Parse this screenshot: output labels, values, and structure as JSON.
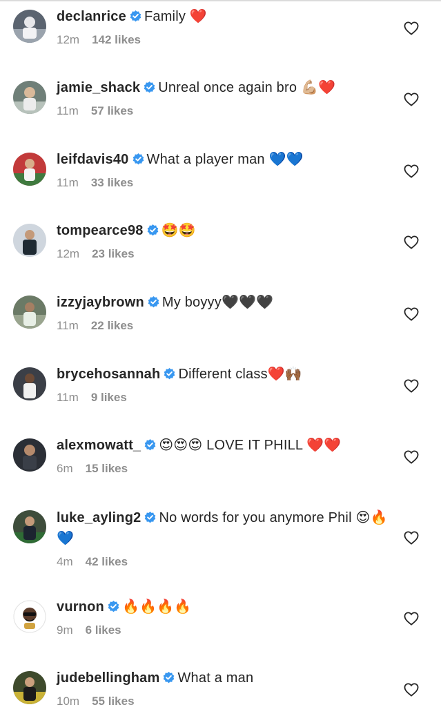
{
  "colors": {
    "text": "#262626",
    "muted": "#8e8e8e",
    "verified": "#3897f0",
    "divider": "#dbdbdb"
  },
  "icons": {
    "verified": "verified-badge-icon",
    "like": "heart-outline-icon"
  },
  "comments": [
    {
      "username": "declanrice",
      "text": "Family ❤️",
      "time": "12m",
      "likes": "142 likes"
    },
    {
      "username": "jamie_shack",
      "text": "Unreal once again bro 💪🏼❤️",
      "time": "11m",
      "likes": "57 likes"
    },
    {
      "username": "leifdavis40",
      "text": "What a player man 💙💙",
      "time": "11m",
      "likes": "33 likes"
    },
    {
      "username": "tompearce98",
      "text": "🤩🤩",
      "time": "12m",
      "likes": "23 likes"
    },
    {
      "username": "izzyjaybrown",
      "text": "My boyyy🖤🖤🖤",
      "time": "11m",
      "likes": "22 likes"
    },
    {
      "username": "brycehosannah",
      "text": "Different class❤️🙌🏾",
      "time": "11m",
      "likes": "9 likes"
    },
    {
      "username": "alexmowatt_",
      "text": "😍😍😍 LOVE IT PHILL ❤️❤️",
      "time": "6m",
      "likes": "15 likes"
    },
    {
      "username": "luke_ayling2",
      "text": "No words for you anymore Phil 😍🔥💙",
      "time": "4m",
      "likes": "42 likes"
    },
    {
      "username": "vurnon",
      "text": "🔥🔥🔥🔥",
      "time": "9m",
      "likes": "6 likes"
    },
    {
      "username": "judebellingham",
      "text": "What a man",
      "time": "10m",
      "likes": "55 likes"
    }
  ]
}
